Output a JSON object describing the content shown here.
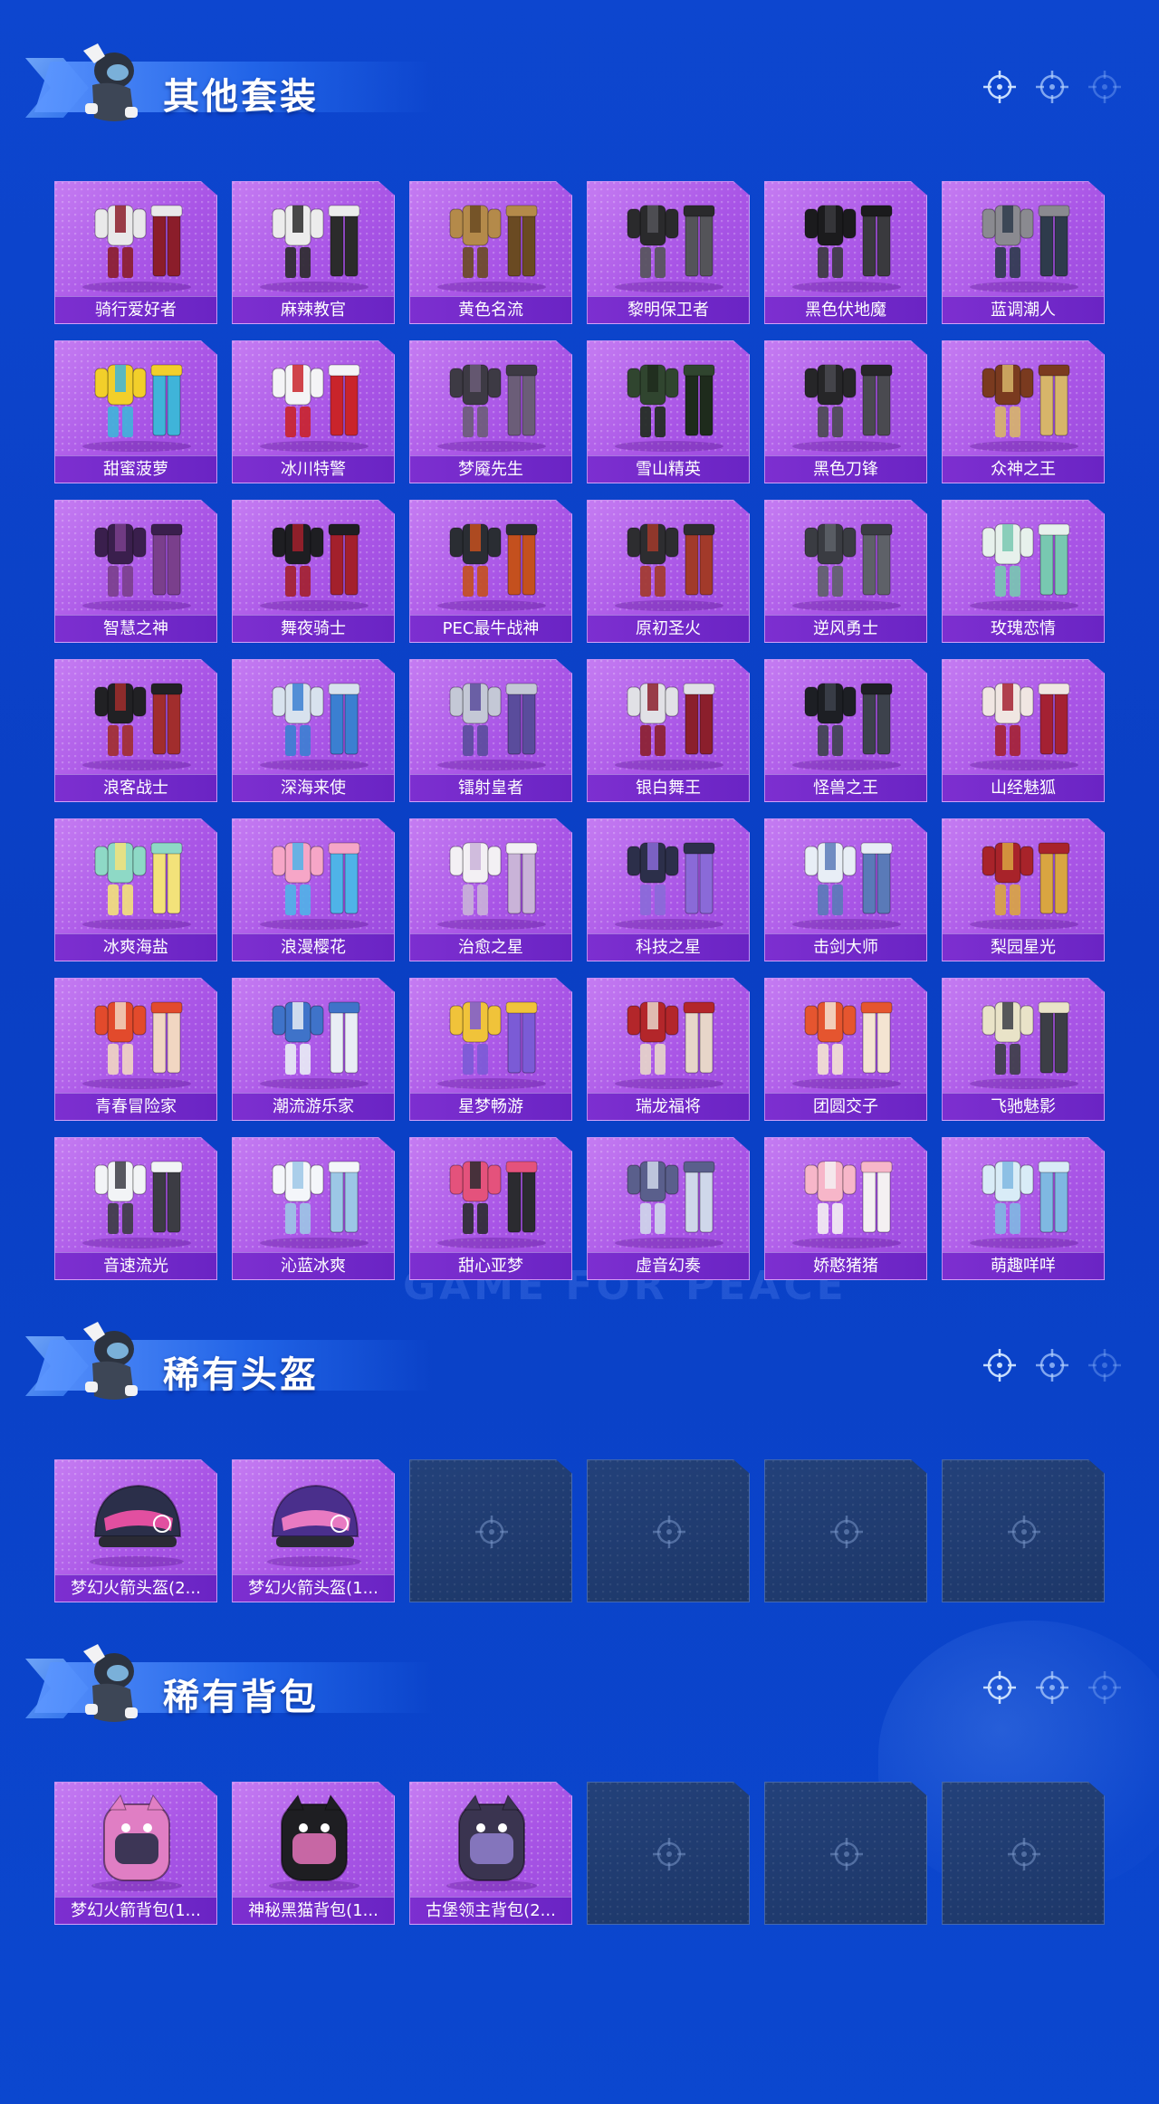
{
  "watermark": "GAME FOR PEACE",
  "sections": [
    {
      "title": "其他套装",
      "slots": [
        {
          "name": "骑行爱好者",
          "icon": "outfit-icon",
          "c1": "#e9e9ea",
          "c2": "#8b1d2a"
        },
        {
          "name": "麻辣教官",
          "icon": "outfit-icon",
          "c1": "#ececec",
          "c2": "#2b2b2b"
        },
        {
          "name": "黄色名流",
          "icon": "outfit-icon",
          "c1": "#b48a4a",
          "c2": "#6a4a22"
        },
        {
          "name": "黎明保卫者",
          "icon": "outfit-icon",
          "c1": "#2a2a2c",
          "c2": "#545459"
        },
        {
          "name": "黑色伏地魔",
          "icon": "outfit-icon",
          "c1": "#1b1b1d",
          "c2": "#3a3a3e"
        },
        {
          "name": "蓝调潮人",
          "icon": "outfit-icon",
          "c1": "#8a8a90",
          "c2": "#2e3b4c"
        },
        {
          "name": "甜蜜菠萝",
          "icon": "outfit-icon",
          "c1": "#f2cf2a",
          "c2": "#3fb4d9"
        },
        {
          "name": "冰川特警",
          "icon": "outfit-icon",
          "c1": "#f4f4f6",
          "c2": "#c9242b"
        },
        {
          "name": "梦魇先生",
          "icon": "outfit-icon",
          "c1": "#3d3a44",
          "c2": "#6b5d78"
        },
        {
          "name": "雪山精英",
          "icon": "outfit-icon",
          "c1": "#30452f",
          "c2": "#1e2b1c"
        },
        {
          "name": "黑色刀锋",
          "icon": "outfit-icon",
          "c1": "#262628",
          "c2": "#4a4a50"
        },
        {
          "name": "众神之王",
          "icon": "outfit-icon",
          "c1": "#7a3a1f",
          "c2": "#d7b56a"
        },
        {
          "name": "智慧之神",
          "icon": "outfit-icon",
          "c1": "#3a1f4d",
          "c2": "#7a3f8c"
        },
        {
          "name": "舞夜骑士",
          "icon": "outfit-icon",
          "c1": "#1e1e22",
          "c2": "#a3202c"
        },
        {
          "name": "PEC最牛战神",
          "icon": "outfit-icon",
          "c1": "#2a2d33",
          "c2": "#c4501e"
        },
        {
          "name": "原初圣火",
          "icon": "outfit-icon",
          "c1": "#2d2d30",
          "c2": "#a23a2a"
        },
        {
          "name": "逆风勇士",
          "icon": "outfit-icon",
          "c1": "#3a3c42",
          "c2": "#5e6168"
        },
        {
          "name": "玫瑰恋情",
          "icon": "outfit-icon",
          "c1": "#e7f1ec",
          "c2": "#78c8b1"
        },
        {
          "name": "浪客战士",
          "icon": "outfit-icon",
          "c1": "#212124",
          "c2": "#a12d2d"
        },
        {
          "name": "深海来使",
          "icon": "outfit-icon",
          "c1": "#d8e2ee",
          "c2": "#3b7fd1"
        },
        {
          "name": "镭射皇者",
          "icon": "outfit-icon",
          "c1": "#c4c8d6",
          "c2": "#5a4c9c"
        },
        {
          "name": "银白舞王",
          "icon": "outfit-icon",
          "c1": "#e1e1e6",
          "c2": "#8b1f2c"
        },
        {
          "name": "怪兽之王",
          "icon": "outfit-icon",
          "c1": "#1d1f24",
          "c2": "#3d424c"
        },
        {
          "name": "山经魅狐",
          "icon": "outfit-icon",
          "c1": "#f0e6e2",
          "c2": "#a42133"
        },
        {
          "name": "冰爽海盐",
          "icon": "outfit-icon",
          "c1": "#8ed9c6",
          "c2": "#f3e27a"
        },
        {
          "name": "浪漫樱花",
          "icon": "outfit-icon",
          "c1": "#f6a6c7",
          "c2": "#4fb3e8"
        },
        {
          "name": "治愈之星",
          "icon": "outfit-icon",
          "c1": "#f3f0f4",
          "c2": "#c9b3d8"
        },
        {
          "name": "科技之星",
          "icon": "outfit-icon",
          "c1": "#2c2f4a",
          "c2": "#8a6ad8"
        },
        {
          "name": "击剑大师",
          "icon": "outfit-icon",
          "c1": "#e8eef6",
          "c2": "#5a7ab8"
        },
        {
          "name": "梨园星光",
          "icon": "outfit-icon",
          "c1": "#a8232a",
          "c2": "#d9a541"
        },
        {
          "name": "青春冒险家",
          "icon": "outfit-icon",
          "c1": "#e24a2c",
          "c2": "#f1d6c2"
        },
        {
          "name": "潮流游乐家",
          "icon": "outfit-icon",
          "c1": "#3f73c9",
          "c2": "#e9edf5"
        },
        {
          "name": "星梦畅游",
          "icon": "outfit-icon",
          "c1": "#f0c33a",
          "c2": "#7b5bd6"
        },
        {
          "name": "瑞龙福将",
          "icon": "outfit-icon",
          "c1": "#b3262a",
          "c2": "#e7d6c9"
        },
        {
          "name": "团圆交子",
          "icon": "outfit-icon",
          "c1": "#e5552f",
          "c2": "#f4e4d2"
        },
        {
          "name": "飞驰魅影",
          "icon": "outfit-icon",
          "c1": "#e9e3c8",
          "c2": "#3c3e46"
        },
        {
          "name": "音速流光",
          "icon": "outfit-icon",
          "c1": "#f2f4f6",
          "c2": "#3c3c44"
        },
        {
          "name": "沁蓝冰爽",
          "icon": "outfit-icon",
          "c1": "#f4f6fa",
          "c2": "#9cc7e6"
        },
        {
          "name": "甜心亚梦",
          "icon": "outfit-icon",
          "c1": "#e4527c",
          "c2": "#2b2b30"
        },
        {
          "name": "虚音幻奏",
          "icon": "outfit-icon",
          "c1": "#5a5f8c",
          "c2": "#cfd7ea"
        },
        {
          "name": "娇憨猪猪",
          "icon": "outfit-icon",
          "c1": "#f7b6c9",
          "c2": "#f4f0f2"
        },
        {
          "name": "萌趣咩咩",
          "icon": "outfit-icon",
          "c1": "#d9ecf7",
          "c2": "#7fb8e2"
        }
      ]
    },
    {
      "title": "稀有头盔",
      "slots": [
        {
          "name": "梦幻火箭头盔(2...",
          "icon": "helmet-icon",
          "c1": "#2b2f4a",
          "c2": "#e24fa0"
        },
        {
          "name": "梦幻火箭头盔(1...",
          "icon": "helmet-icon",
          "c1": "#4a2f8c",
          "c2": "#e87ac2"
        },
        {
          "empty": true
        },
        {
          "empty": true
        },
        {
          "empty": true
        },
        {
          "empty": true
        }
      ]
    },
    {
      "title": "稀有背包",
      "slots": [
        {
          "name": "梦幻火箭背包(1...",
          "icon": "backpack-icon",
          "c1": "#e07ec4",
          "c2": "#2b2f4a"
        },
        {
          "name": "神秘黑猫背包(1...",
          "icon": "backpack-icon",
          "c1": "#1e1e22",
          "c2": "#d96fb3"
        },
        {
          "name": "古堡领主背包(2...",
          "icon": "backpack-icon",
          "c1": "#3a3450",
          "c2": "#8d7cc8"
        },
        {
          "empty": true
        },
        {
          "empty": true
        },
        {
          "empty": true
        }
      ]
    }
  ],
  "colors": {
    "background": "#0b44cc",
    "card_purple": "#a955e6",
    "label_bar": "#7d2fd0",
    "empty_slot": "#1f3a6e"
  }
}
